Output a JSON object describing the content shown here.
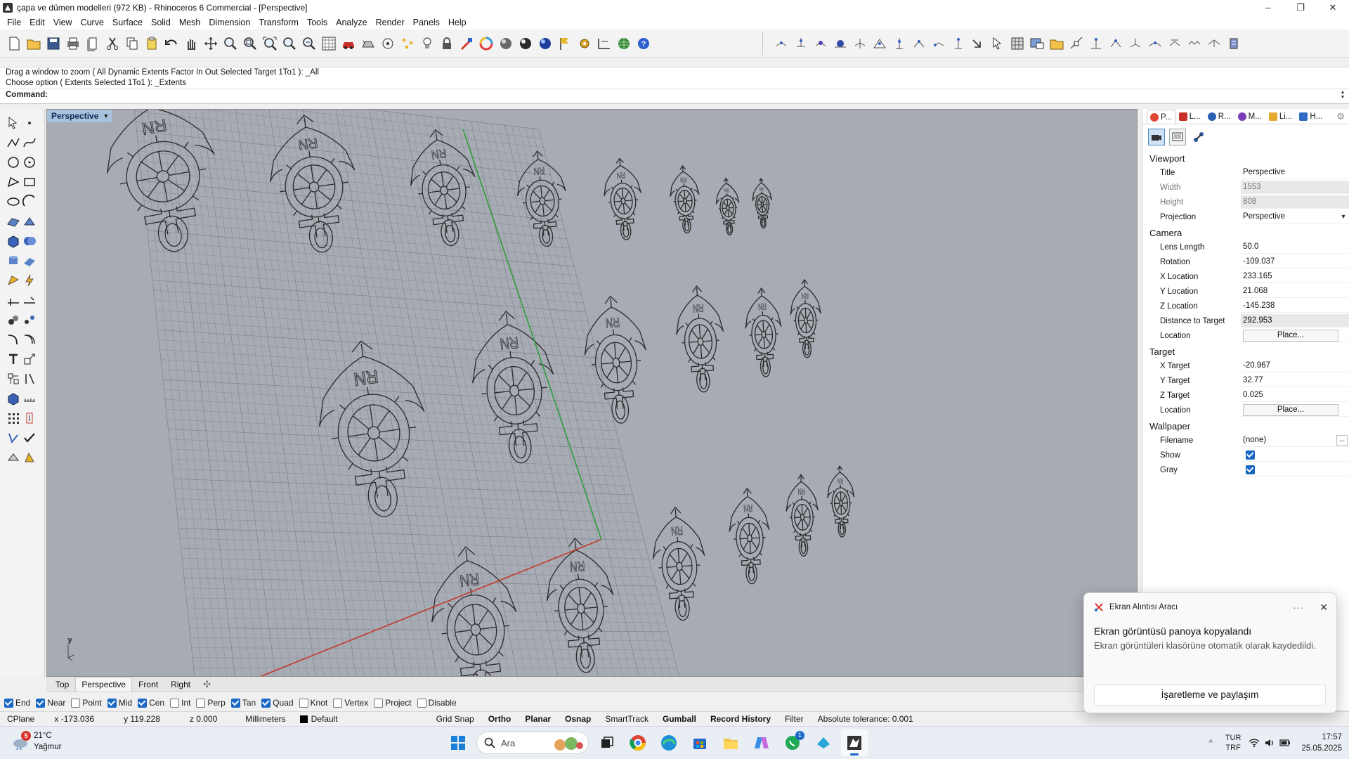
{
  "window": {
    "title": "çapa ve dümen modelleri (972 KB) - Rhinoceros 6 Commercial - [Perspective]",
    "minimize": "–",
    "maximize": "❐",
    "close": "✕"
  },
  "menu": [
    "File",
    "Edit",
    "View",
    "Curve",
    "Surface",
    "Solid",
    "Mesh",
    "Dimension",
    "Transform",
    "Tools",
    "Analyze",
    "Render",
    "Panels",
    "Help"
  ],
  "command": {
    "history": [
      "Drag a window to zoom ( All  Dynamic  Extents  Factor  In  Out  Selected  Target  1To1 ): _All",
      "Choose option ( Extents  Selected  1To1 ): _Extents"
    ],
    "prompt_label": "Command:",
    "value": ""
  },
  "viewport": {
    "label": "Perspective",
    "axis_y": "y",
    "engraving": "RN"
  },
  "viewport_tabs": [
    "Top",
    "Perspective",
    "Front",
    "Right"
  ],
  "viewport_tab_active": "Perspective",
  "osnaps": [
    {
      "label": "End",
      "checked": true
    },
    {
      "label": "Near",
      "checked": true
    },
    {
      "label": "Point",
      "checked": false
    },
    {
      "label": "Mid",
      "checked": true
    },
    {
      "label": "Cen",
      "checked": true
    },
    {
      "label": "Int",
      "checked": false
    },
    {
      "label": "Perp",
      "checked": false
    },
    {
      "label": "Tan",
      "checked": true
    },
    {
      "label": "Quad",
      "checked": true
    },
    {
      "label": "Knot",
      "checked": false
    },
    {
      "label": "Vertex",
      "checked": false
    },
    {
      "label": "Project",
      "checked": false
    },
    {
      "label": "Disable",
      "checked": false
    }
  ],
  "status": {
    "cplane": "CPlane",
    "x": "x -173.036",
    "y": "y 119.228",
    "z": "z 0.000",
    "units": "Millimeters",
    "layer": "Default",
    "grid_snap": "Grid Snap",
    "ortho": "Ortho",
    "planar": "Planar",
    "osnap": "Osnap",
    "smarttrack": "SmartTrack",
    "gumball": "Gumball",
    "record_history": "Record History",
    "filter": "Filter",
    "tolerance": "Absolute tolerance: 0.001"
  },
  "panel": {
    "tabs": [
      {
        "label": "P...",
        "color": "#e0452f"
      },
      {
        "label": "L...",
        "color": "#c8322b"
      },
      {
        "label": "R...",
        "color": "#2a5fb3"
      },
      {
        "label": "M...",
        "color": "#7a3fb8"
      },
      {
        "label": "Li...",
        "color": "#e6a92f"
      },
      {
        "label": "H...",
        "color": "#2f6bc4"
      }
    ],
    "viewport_section": "Viewport",
    "camera_section": "Camera",
    "target_section": "Target",
    "wallpaper_section": "Wallpaper",
    "title_label": "Title",
    "title_value": "Perspective",
    "width_label": "Width",
    "width_value": "1553",
    "height_label": "Height",
    "height_value": "808",
    "projection_label": "Projection",
    "projection_value": "Perspective",
    "lens_label": "Lens Length",
    "lens_value": "50.0",
    "rotation_label": "Rotation",
    "rotation_value": "-109.037",
    "xloc_label": "X Location",
    "xloc_value": "233.165",
    "yloc_label": "Y Location",
    "yloc_value": "21.068",
    "zloc_label": "Z Location",
    "zloc_value": "-145.238",
    "dist_label": "Distance to Target",
    "dist_value": "292.953",
    "location_label": "Location",
    "place_button": "Place...",
    "xt_label": "X Target",
    "xt_value": "-20.967",
    "yt_label": "Y Target",
    "yt_value": "32.77",
    "zt_label": "Z Target",
    "zt_value": "0.025",
    "tlocation_label": "Location",
    "filename_label": "Filename",
    "filename_value": "(none)",
    "show_label": "Show",
    "gray_label": "Gray",
    "dots": "..."
  },
  "toast": {
    "app": "Ekran Alıntısı Aracı",
    "more": "···",
    "close": "✕",
    "title": "Ekran görüntüsü panoya kopyalandı",
    "body": "Ekran görüntüleri klasörüne otomatik olarak kaydedildi.",
    "button": "İşaretleme ve paylaşım"
  },
  "taskbar": {
    "weather_badge": "5",
    "temp": "21°C",
    "condition": "Yağmur",
    "search_placeholder": "Ara",
    "whatsapp_badge": "1",
    "lang_top": "TUR",
    "lang_bottom": "TRF",
    "time": "17:57",
    "date": "25.05.2025",
    "tray_arrow": "^"
  },
  "colors": {
    "viewport_bg": "#a7abb3",
    "grid": "#8f949c",
    "x_axis": "#c23a2c",
    "y_axis": "#2f9c3a",
    "accent": "#1a68c5"
  }
}
